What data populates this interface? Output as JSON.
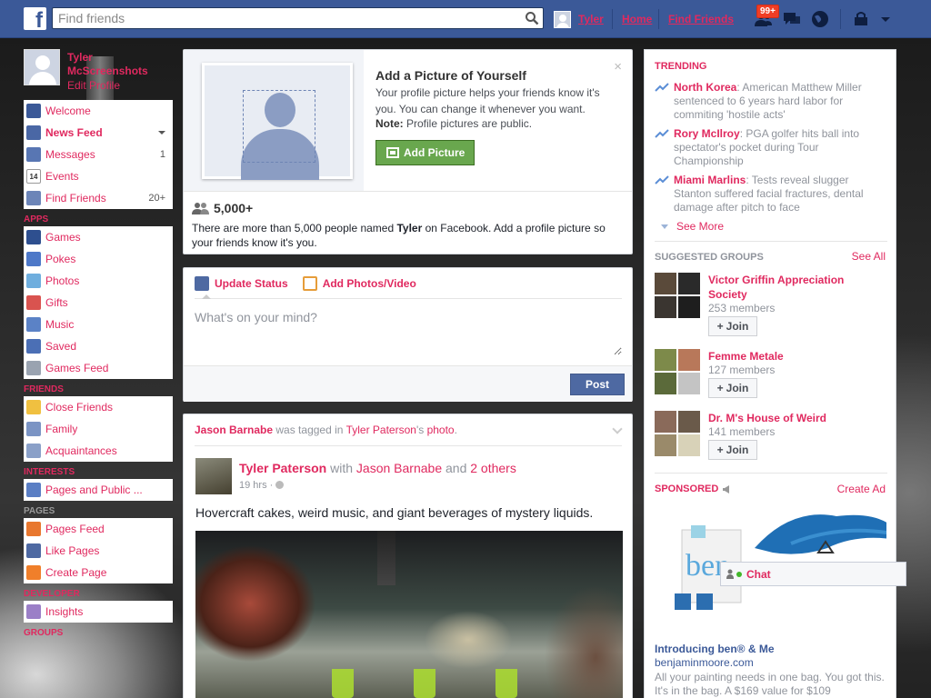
{
  "topbar": {
    "logo": "f",
    "search_placeholder": "Find friends",
    "user_name": "Tyler",
    "home": "Home",
    "find_friends": "Find Friends",
    "friend_requests_badge": "99+"
  },
  "leftnav": {
    "profile_name": "Tyler McScreenshots",
    "edit_profile": "Edit Profile",
    "main_items": [
      {
        "label": "Welcome",
        "icon": "facebook-icon"
      },
      {
        "label": "News Feed",
        "icon": "news-feed-icon"
      },
      {
        "label": "Messages",
        "icon": "messages-icon",
        "count": "1"
      },
      {
        "label": "Events",
        "icon": "calendar-icon",
        "date": "14"
      },
      {
        "label": "Find Friends",
        "icon": "find-friends-icon",
        "count": "20+"
      }
    ],
    "apps_head": "APPS",
    "apps": [
      "Games",
      "Pokes",
      "Photos",
      "Gifts",
      "Music",
      "Saved",
      "Games Feed"
    ],
    "friends_head": "FRIENDS",
    "friends": [
      "Close Friends",
      "Family",
      "Acquaintances"
    ],
    "interests_head": "INTERESTS",
    "interests": [
      "Pages and Public ..."
    ],
    "pages_head": "PAGES",
    "pages": [
      "Pages Feed",
      "Like Pages",
      "Create Page"
    ],
    "developer_head": "DEVELOPER",
    "developer": [
      "Insights"
    ],
    "groups_head": "GROUPS"
  },
  "profile_prompt": {
    "title": "Add a Picture of Yourself",
    "desc": "Your profile picture helps your friends know it's you. You can change it whenever you want.",
    "note_label": "Note:",
    "note_text": " Profile pictures are public.",
    "button": "Add Picture",
    "close": "×",
    "count": "5,000+",
    "count_desc_1": "There are more than 5,000 people named ",
    "count_desc_name": "Tyler",
    "count_desc_2": " on Facebook. Add a profile picture so your friends know it's you."
  },
  "composer": {
    "tab_status": "Update Status",
    "tab_photos": "Add Photos/Video",
    "placeholder": "What's on your mind?",
    "post": "Post"
  },
  "story": {
    "head_actor": "Jason Barnabe",
    "head_mid": " was tagged in ",
    "head_owner": "Tyler Paterson",
    "head_possessive": "'s ",
    "head_photo": "photo",
    "head_end": ".",
    "author": "Tyler Paterson",
    "with": " with ",
    "with_name": "Jason Barnabe",
    "and": " and ",
    "others": "2 others",
    "time": "19 hrs · ",
    "text": "Hovercraft cakes, weird music, and giant beverages of mystery liquids."
  },
  "trending": {
    "title": "TRENDING",
    "items": [
      {
        "name": "North Korea",
        "text": ": American Matthew Miller sentenced to 6 years hard labor for commiting 'hostile acts'"
      },
      {
        "name": "Rory McIlroy",
        "text": ": PGA golfer hits ball into spectator's pocket during Tour Championship"
      },
      {
        "name": "Miami Marlins",
        "text": ": Tests reveal slugger Stanton suffered facial fractures, dental damage after pitch to face"
      }
    ],
    "see_more": "See More"
  },
  "suggested_groups": {
    "title": "SUGGESTED GROUPS",
    "see_all": "See All",
    "join": "Join",
    "groups": [
      {
        "name": "Victor Griffin Appreciation Society",
        "members": "253 members"
      },
      {
        "name": "Femme Metale",
        "members": "127 members"
      },
      {
        "name": "Dr. M's House of Weird",
        "members": "141 members"
      }
    ]
  },
  "sponsored": {
    "title": "SPONSORED",
    "create_ad": "Create Ad",
    "ad_title": "Introducing ben® & Me",
    "ad_url": "benjaminmoore.com",
    "ad_desc": "All your painting needs in one bag. You got this. It's in the bag. A $169 value for $109"
  },
  "chat": {
    "label": "Chat"
  },
  "colors": {
    "brand": "#3b5998",
    "link": "#e0295f",
    "green_button": "#69a74e",
    "online": "#42b72a"
  }
}
